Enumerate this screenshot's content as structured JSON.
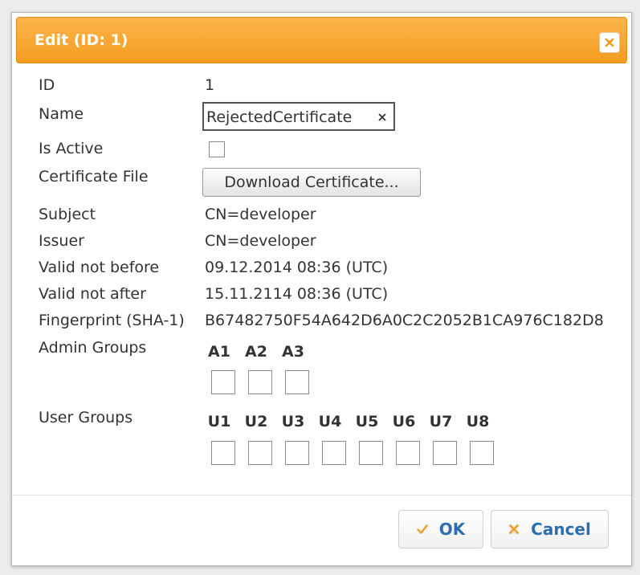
{
  "dialog": {
    "title": "Edit (ID: 1)",
    "close_icon": "close-icon"
  },
  "form": {
    "id_label": "ID",
    "id_value": "1",
    "name_label": "Name",
    "name_value": "RejectedCertificate",
    "is_active_label": "Is Active",
    "is_active_checked": false,
    "cert_file_label": "Certificate File",
    "download_label": "Download Certificate...",
    "subject_label": "Subject",
    "subject_value": "CN=developer",
    "issuer_label": "Issuer",
    "issuer_value": "CN=developer",
    "valid_before_label": "Valid not before",
    "valid_before_value": "09.12.2014 08:36 (UTC)",
    "valid_after_label": "Valid not after",
    "valid_after_value": "15.11.2114 08:36 (UTC)",
    "fingerprint_label": "Fingerprint (SHA-1)",
    "fingerprint_value": "B67482750F54A642D6A0C2C2052B1CA976C182D8",
    "admin_groups_label": "Admin Groups",
    "admin_groups": [
      "A1",
      "A2",
      "A3"
    ],
    "user_groups_label": "User Groups",
    "user_groups": [
      "U1",
      "U2",
      "U3",
      "U4",
      "U5",
      "U6",
      "U7",
      "U8"
    ]
  },
  "footer": {
    "ok_label": "OK",
    "cancel_label": "Cancel"
  },
  "colors": {
    "titlebar": "#f5a533",
    "button_text": "#2c6fb0",
    "ok_icon": "#f0a030",
    "cancel_icon": "#f0a030"
  }
}
